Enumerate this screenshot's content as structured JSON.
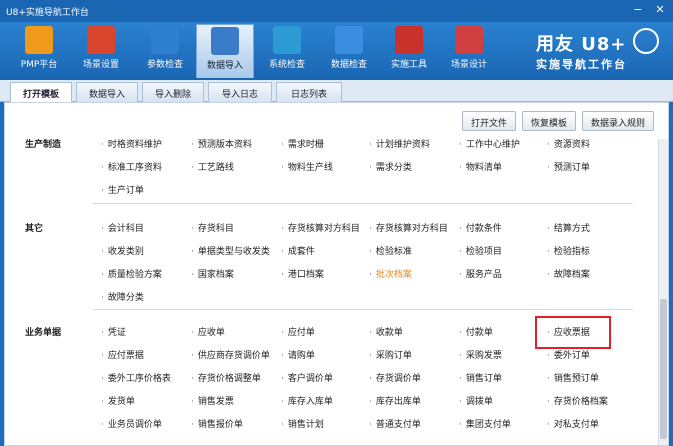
{
  "window": {
    "title": "U8+实施导航工作台"
  },
  "toolbar": {
    "items": [
      {
        "label": "PMP平台",
        "color": "#f09a1c"
      },
      {
        "label": "场景设置",
        "color": "#d9462d"
      },
      {
        "label": "参数检查",
        "color": "#2f7fd0"
      },
      {
        "label": "数据导入",
        "color": "#3a7cc9",
        "active": true
      },
      {
        "label": "系统检查",
        "color": "#2b9bd3"
      },
      {
        "label": "数据检查",
        "color": "#3b8de0"
      },
      {
        "label": "实施工具",
        "color": "#c8322b"
      },
      {
        "label": "场景设计",
        "color": "#d04040"
      }
    ],
    "brand_line1": "用友 U8+",
    "brand_line2": "实施导航工作台"
  },
  "tabs": [
    "打开模板",
    "数据导入",
    "导入删除",
    "导入日志",
    "日志列表"
  ],
  "actions": [
    "打开文件",
    "恢复模板",
    "数据录入规则"
  ],
  "sections": [
    {
      "name": "生产制造",
      "rows": [
        [
          "时格资料维护",
          "预测版本资料",
          "需求时栅",
          "计划维护资料",
          "工作中心维护",
          "资源资料"
        ],
        [
          "标准工序资料",
          "工艺路线",
          "物料生产线",
          "需求分类",
          "物料清单",
          "预测订单"
        ],
        [
          "生产订单"
        ]
      ]
    },
    {
      "name": "其它",
      "rows": [
        [
          "会计科目",
          "存货科目",
          "存货核算对方科目",
          "存货核算对方科目",
          "付款条件",
          "结算方式"
        ],
        [
          "收发类别",
          "单据类型与收发类",
          "成套件",
          "检验标准",
          "检验项目",
          "检验指标"
        ],
        [
          "质量检验方案",
          "国家档案",
          "港口档案",
          "批次档案",
          "服务产品",
          "故障档案"
        ],
        [
          "故障分类"
        ]
      ],
      "highlight": "批次档案"
    },
    {
      "name": "业务单据",
      "rows": [
        [
          "凭证",
          "应收单",
          "应付单",
          "收款单",
          "付款单",
          "应收票据"
        ],
        [
          "应付票据",
          "供应商存货调价单",
          "请购单",
          "采购订单",
          "采购发票",
          "委外订单"
        ],
        [
          "委外工序价格表",
          "存货价格调整单",
          "客户调价单",
          "存货调价单",
          "销售订单",
          "销售预订单"
        ],
        [
          "发货单",
          "销售发票",
          "库存入库单",
          "库存出库单",
          "调拨单",
          "存货价格档案"
        ],
        [
          "业务员调价单",
          "销售报价单",
          "销售计划",
          "普通支付单",
          "集团支付单",
          "对私支付单"
        ]
      ]
    }
  ]
}
